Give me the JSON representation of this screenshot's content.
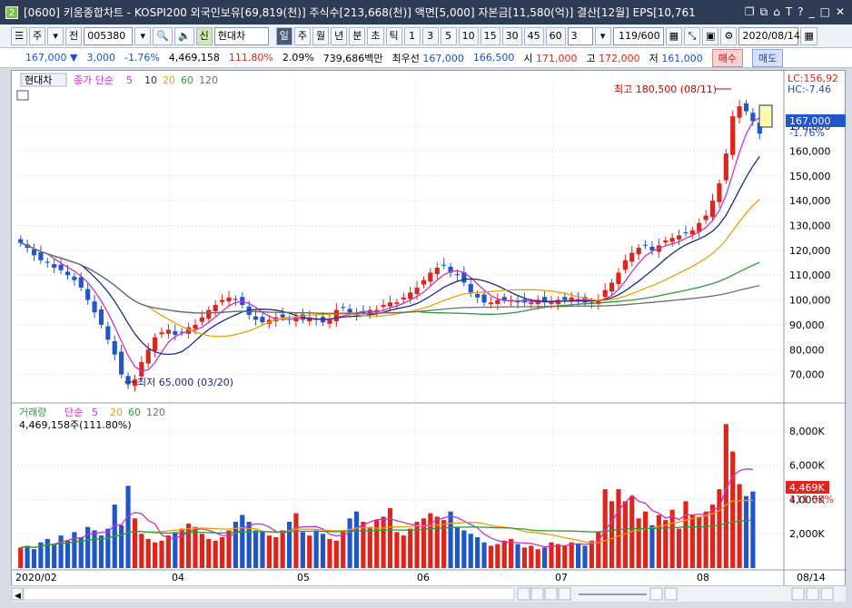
{
  "window": {
    "title": "[0600] 키움종합차트 - KOSPI200 외국인보유[69,819(천)] 주식수[213,668(천)] 액면[5,000] 자본금[11,580(억)] 결산[12월] EPS[10,761",
    "app_badge": "2",
    "icons": [
      "restore-icon",
      "new-window-icon",
      "pin-icon",
      "font-icon",
      "help-icon",
      "minimize-icon",
      "maximize-icon",
      "close-icon"
    ]
  },
  "toolbar": {
    "type_select": "주",
    "prev_label": "전",
    "code": "005380",
    "credit_badge": "신",
    "stock_name": "현대차",
    "periods": [
      "일",
      "주",
      "월",
      "년",
      "분",
      "초",
      "틱"
    ],
    "minutes": [
      "1",
      "3",
      "5",
      "10",
      "15",
      "30",
      "45",
      "60"
    ],
    "custom_period": "3",
    "count": "119/600",
    "date": "2020/08/14"
  },
  "quote": {
    "price": "167,000",
    "change": "3,000",
    "change_pct": "-1.76%",
    "volume": "4,469,158",
    "volume_ratio": "111.80%",
    "turnover": "2.09%",
    "amount": "739,686백만",
    "best_label": "최우선",
    "bid": "167,000",
    "ask": "166,500",
    "open_label": "시",
    "open": "171,000",
    "high_label": "고",
    "high": "172,000",
    "low_label": "저",
    "low": "161,000",
    "buy_label": "매수",
    "sell_label": "매도"
  },
  "price_panel": {
    "stock_tag": "현대차",
    "ma_label": "종가 단순",
    "ma_periods": [
      "5",
      "10",
      "20",
      "60",
      "120"
    ],
    "lc": "LC:156,92",
    "hc": "HC:-7.46",
    "current_price": "167,000",
    "current_change": "-1.76%",
    "high_annotation": "최고 180,500 (08/11)",
    "low_annotation": "최저 65,000 (03/20)",
    "y_ticks": [
      "170,000",
      "160,000",
      "150,000",
      "140,000",
      "130,000",
      "120,000",
      "110,000",
      "100,000",
      "90,000",
      "80,000",
      "70,000"
    ]
  },
  "volume_panel": {
    "title": "거래량",
    "ma_label": "단순",
    "ma_periods": [
      "5",
      "20",
      "60",
      "120"
    ],
    "last_volume": "4,469,158주(111.80%)",
    "current_badge": "4,469K",
    "current_ratio": "111.80%",
    "y_ticks": [
      "8,000K",
      "6,000K",
      "4,000K",
      "2,000K"
    ]
  },
  "x_axis": {
    "labels": [
      "2020/02",
      "04",
      "05",
      "06",
      "07",
      "08",
      "08/14"
    ]
  },
  "colors": {
    "up": "#e0241b",
    "down": "#1f56c8",
    "ma5": "#c832c8",
    "ma10": "#1a2a8a",
    "ma20": "#e8a000",
    "ma60": "#2a9a3a",
    "ma120": "#6e6e6e"
  },
  "chart_data": {
    "type": "candlestick",
    "x_start": "2020/02/03",
    "x_end": "2020/08/14",
    "ylim": [
      60000,
      185000
    ],
    "ohlc_close_approx": [
      123000,
      121000,
      118000,
      116000,
      115000,
      113000,
      112000,
      110000,
      108000,
      105000,
      100000,
      95000,
      90000,
      84000,
      78000,
      70000,
      66000,
      68000,
      75000,
      80000,
      85000,
      87000,
      88000,
      86000,
      87000,
      89000,
      90000,
      93000,
      96000,
      98000,
      100000,
      101000,
      100000,
      98000,
      94000,
      92000,
      91000,
      92000,
      93000,
      93000,
      92000,
      93000,
      92000,
      93000,
      92000,
      91000,
      92000,
      96000,
      97000,
      95000,
      94000,
      95000,
      96000,
      96000,
      98000,
      99000,
      99000,
      101000,
      103000,
      105000,
      108000,
      111000,
      113000,
      114000,
      111000,
      110000,
      107000,
      103000,
      101000,
      99000,
      99000,
      100000,
      100000,
      100000,
      99000,
      99000,
      99000,
      100000,
      99000,
      99000,
      100000,
      100000,
      101000,
      100000,
      99000,
      99000,
      100000,
      104000,
      107000,
      111000,
      116000,
      119000,
      121000,
      122000,
      120000,
      122000,
      124000,
      125000,
      126000,
      127000,
      128000,
      131000,
      134000,
      140000,
      147000,
      159000,
      174000,
      178000,
      176000,
      172000,
      167000
    ],
    "volume_k_approx": [
      1200,
      1300,
      1100,
      1500,
      1700,
      1400,
      1900,
      1600,
      2100,
      1800,
      2400,
      2200,
      1900,
      2300,
      3700,
      2500,
      4800,
      2900,
      2000,
      1700,
      1500,
      1600,
      1900,
      2100,
      2300,
      2600,
      2400,
      2000,
      1700,
      1600,
      1800,
      2200,
      2700,
      3100,
      2700,
      2200,
      2100,
      1900,
      1800,
      2200,
      2700,
      3200,
      2100,
      1900,
      2200,
      2000,
      1700,
      1600,
      2100,
      2900,
      3300,
      2700,
      2400,
      2800,
      3000,
      3500,
      2100,
      1900,
      2300,
      2700,
      2900,
      3200,
      3000,
      2800,
      3300,
      2400,
      2200,
      2000,
      1800,
      1500,
      1300,
      1400,
      1600,
      1700,
      1400,
      1200,
      1300,
      1100,
      1200,
      1500,
      1400,
      1300,
      1500,
      1400,
      1300,
      1600,
      2100,
      4600,
      3900,
      4600,
      3900,
      4200,
      2900,
      3300,
      2500,
      3100,
      2800,
      3400,
      2300,
      3900,
      3100,
      3000,
      3300,
      3700,
      4600,
      8400,
      6800,
      4900,
      4200,
      4469
    ]
  }
}
